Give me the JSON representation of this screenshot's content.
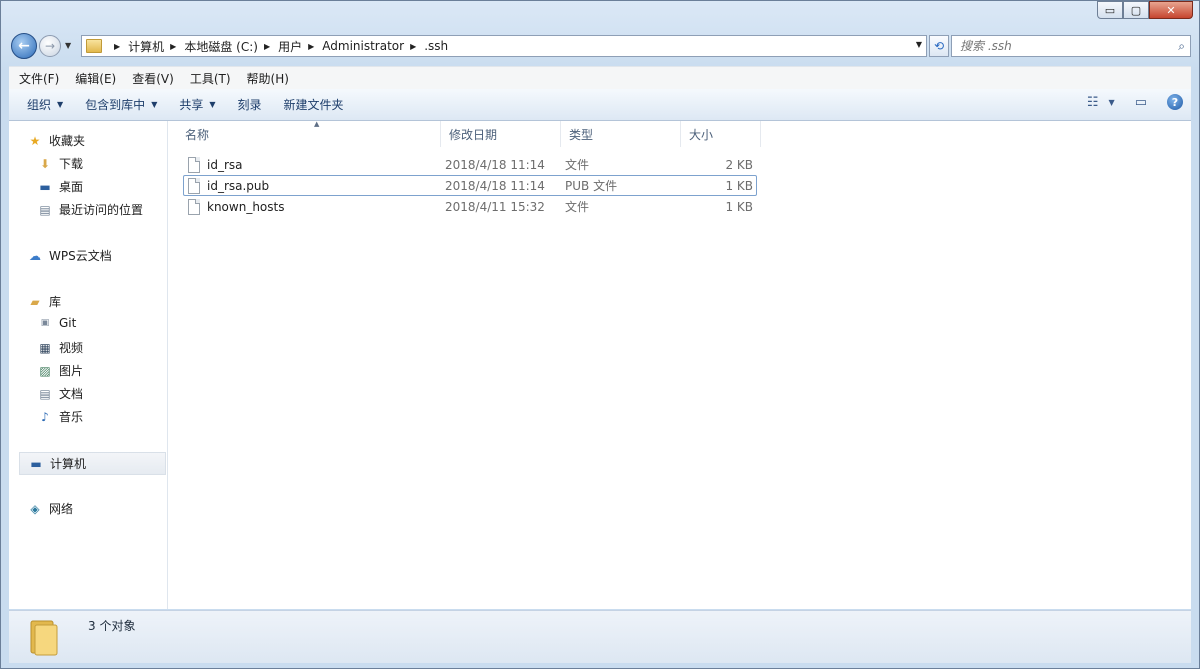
{
  "window": {
    "controls": {
      "minimize": "▭",
      "maximize": "▢",
      "close": "✕"
    }
  },
  "address": {
    "crumbs": [
      "计算机",
      "本地磁盘 (C:)",
      "用户",
      "Administrator",
      ".ssh"
    ]
  },
  "search": {
    "placeholder": "搜索 .ssh"
  },
  "menubar": {
    "items": [
      "文件(F)",
      "编辑(E)",
      "查看(V)",
      "工具(T)",
      "帮助(H)"
    ]
  },
  "toolbar": {
    "organize": "组织",
    "include_in_library": "包含到库中",
    "share": "共享",
    "burn": "刻录",
    "new_folder": "新建文件夹"
  },
  "sidebar": {
    "favorites": {
      "label": "收藏夹",
      "items": [
        "下载",
        "桌面",
        "最近访问的位置"
      ]
    },
    "wps": "WPS云文档",
    "libraries": {
      "label": "库",
      "items": [
        "Git",
        "视频",
        "图片",
        "文档",
        "音乐"
      ]
    },
    "computer": "计算机",
    "network": "网络"
  },
  "columns": {
    "name": "名称",
    "modified": "修改日期",
    "type": "类型",
    "size": "大小"
  },
  "files": [
    {
      "name": "id_rsa",
      "modified": "2018/4/18 11:14",
      "type": "文件",
      "size": "2 KB"
    },
    {
      "name": "id_rsa.pub",
      "modified": "2018/4/18 11:14",
      "type": "PUB 文件",
      "size": "1 KB"
    },
    {
      "name": "known_hosts",
      "modified": "2018/4/11 15:32",
      "type": "文件",
      "size": "1 KB"
    }
  ],
  "status": {
    "count": "3 个对象"
  },
  "colors": {
    "accent": "#2c6bb8",
    "window_bg": "#c9dcef",
    "folder": "#e2b84d"
  }
}
